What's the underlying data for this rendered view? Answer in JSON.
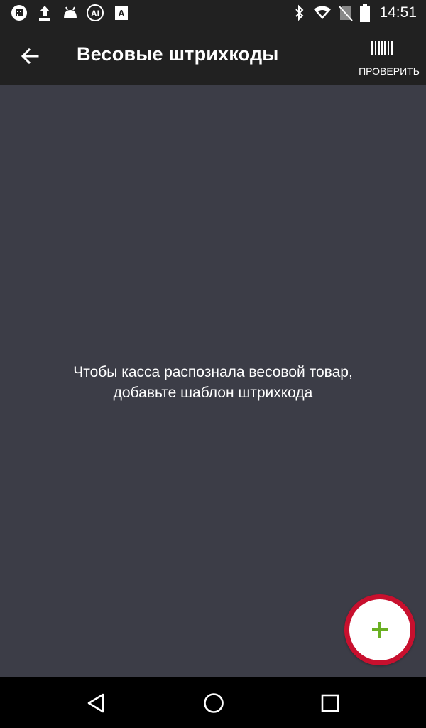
{
  "status_bar": {
    "time": "14:51",
    "left_icons": [
      "shop-notification-icon",
      "upload-icon",
      "android-icon",
      "ai-notification-icon",
      "text-notification-icon"
    ],
    "right_icons": [
      "bluetooth-icon",
      "wifi-icon",
      "no-sim-icon",
      "battery-icon"
    ]
  },
  "app_bar": {
    "title": "Весовые штрихкоды",
    "back_icon": "arrow-back-icon",
    "action": {
      "label": "ПРОВЕРИТЬ",
      "icon": "barcode-icon"
    }
  },
  "main": {
    "empty_message_line1": "Чтобы касса распознала весовой товар,",
    "empty_message_line2": "добавьте шаблон штрихкода"
  },
  "fab": {
    "icon": "plus-icon",
    "icon_color": "#6ab023",
    "highlight_color": "#c8102e"
  },
  "nav_bar": {
    "buttons": [
      "back-triangle-icon",
      "home-circle-icon",
      "recents-square-icon"
    ]
  },
  "colors": {
    "background": "#3c3d47",
    "bars": "#212121",
    "nav": "#000000"
  }
}
